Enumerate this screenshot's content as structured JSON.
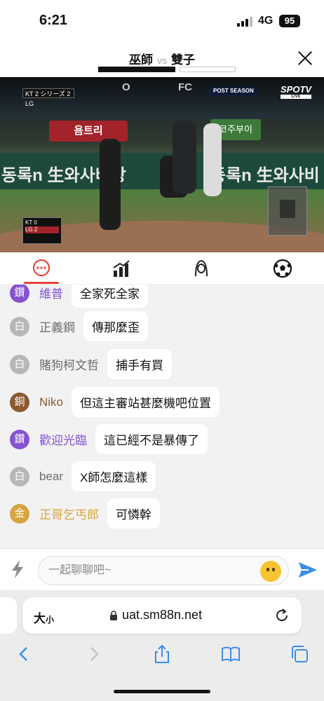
{
  "status_bar": {
    "time": "6:21",
    "network": "4G",
    "battery": "95"
  },
  "header": {
    "home_team": "巫師",
    "vs": "vs",
    "away_team": "雙子"
  },
  "video": {
    "top_score": "KT 2 シリーズ 2 LG",
    "mid_score": "O",
    "sponsor": "FC",
    "postseason": "POST SEASON",
    "broadcaster": "SPOTV",
    "broadcaster_sub": "LIVE",
    "ad_left": "욤트리",
    "ad_right": "코주부이",
    "wall_text_1": "동록n 生와사비랑",
    "wall_text_2": "동록n 生와사비",
    "scoreboard": {
      "team1": "KT",
      "score1": "0",
      "team2": "LG",
      "score2": "2"
    }
  },
  "tabs": [
    {
      "name": "chat",
      "icon": "chat-bubble-icon",
      "active": true
    },
    {
      "name": "stats",
      "icon": "bar-chart-icon",
      "active": false
    },
    {
      "name": "anchor",
      "icon": "person-icon",
      "active": false
    },
    {
      "name": "match",
      "icon": "soccer-ball-icon",
      "active": false
    }
  ],
  "messages": [
    {
      "level": "鑽",
      "level_type": "diamond",
      "user": "維普",
      "text": "全家死全家"
    },
    {
      "level": "白",
      "level_type": "white",
      "user": "正義鋼",
      "text": "傳那麼歪"
    },
    {
      "level": "白",
      "level_type": "white",
      "user": "賭狗柯文哲",
      "text": "捕手有買"
    },
    {
      "level": "銅",
      "level_type": "bronze",
      "user": "Niko",
      "text": "但這主審站甚麼機吧位置"
    },
    {
      "level": "鑽",
      "level_type": "diamond",
      "user": "歡迎光臨",
      "text": "這已經不是暴傳了"
    },
    {
      "level": "白",
      "level_type": "white",
      "user": "bear",
      "text": "X師怎麼這樣"
    },
    {
      "level": "金",
      "level_type": "gold",
      "user": "正哥乞丐郎",
      "text": "可憐幹"
    }
  ],
  "input": {
    "placeholder": "一起聊聊吧~"
  },
  "browser": {
    "text_size_label": "大",
    "text_size_small": "小",
    "url": "uat.sm88n.net"
  },
  "colors": {
    "accent_red": "#e8463a",
    "send_blue": "#3b8ee8",
    "diamond": "#8553d1",
    "gold": "#d6a440",
    "bronze": "#8a5a2f"
  }
}
